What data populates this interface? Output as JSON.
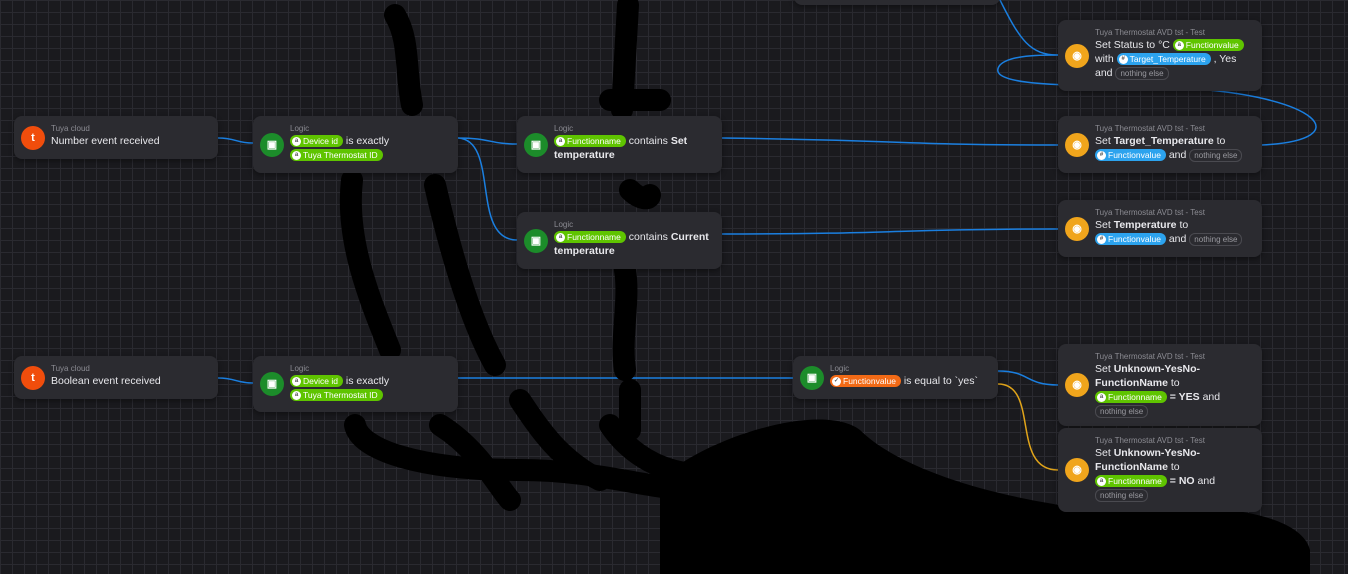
{
  "triggers": [
    {
      "app": "Tuya cloud",
      "title": "Number event received"
    },
    {
      "app": "Tuya cloud",
      "title": "Boolean event received"
    }
  ],
  "logic": {
    "label": "Logic",
    "device_id": "Device id",
    "is_exactly": "is exactly",
    "thermostat_id": "Tuya Thermostat ID",
    "functionname": "Functionname",
    "contains": "contains",
    "set_temperature": "Set temperature",
    "current_temperature": "Current temperature",
    "functionvalue": "Functionvalue",
    "is_equal": "is equal to `yes`"
  },
  "actions": {
    "device": "Tuya Thermostat AVD tst - Test",
    "set": "Set",
    "to": "to",
    "and": "and",
    "nothing_else": "nothing else",
    "status": "Status",
    "status_to": "to °C",
    "with": "with",
    "yes_suffix": ", Yes",
    "target_temperature": "Target_Temperature",
    "temperature": "Temperature",
    "functionvalue": "Functionvalue",
    "functionname": "Functionname",
    "unknown": "Unknown-YesNo-FunctionName",
    "eq_yes": "= YES",
    "eq_no": "= NO"
  },
  "colors": {
    "wire": "#1a7fe0",
    "wire_false": "#e0a41a",
    "logic": "#1c8c2a",
    "tuya": "#f04d0c",
    "action": "#f0a51c"
  }
}
